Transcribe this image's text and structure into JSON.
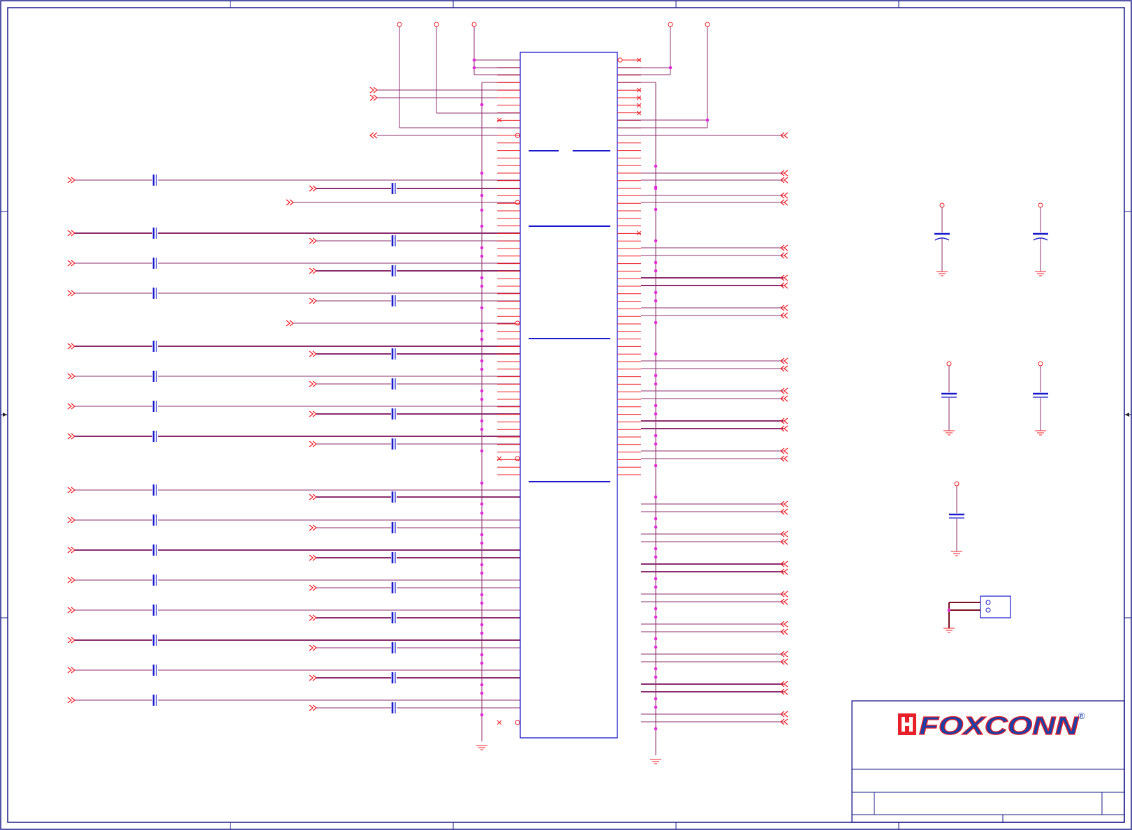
{
  "colors": {
    "background": "#ffffff",
    "wire": "#ed1c24",
    "bus": "#7a1020",
    "net": "#8b2d6e",
    "component": "#1a1acc",
    "junction": "#e02ad8",
    "frame": "#1a1a8a",
    "logo_red": "#e8202a",
    "logo_blue": "#1a3fa6"
  },
  "title_block": {
    "logo_text": "FOXCONN",
    "registered_mark": "®"
  },
  "ic": {
    "left_pin_count": 56,
    "right_pin_count": 56
  },
  "connector": {
    "pin_count": 2
  }
}
